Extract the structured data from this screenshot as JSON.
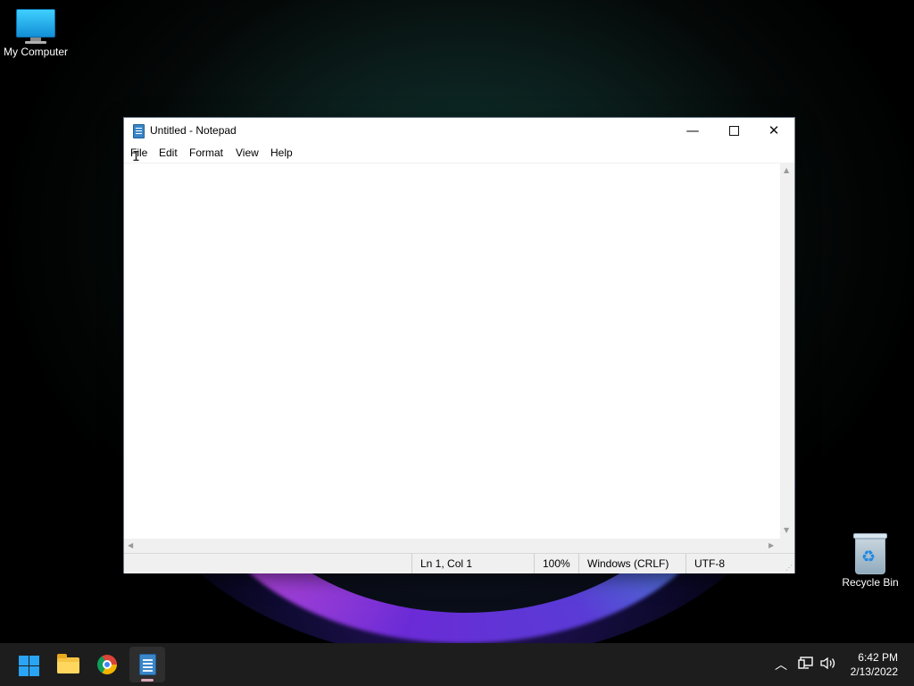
{
  "desktop": {
    "icons": [
      {
        "label": "My Computer"
      },
      {
        "label": "Recycle Bin"
      }
    ]
  },
  "notepad": {
    "title": "Untitled - Notepad",
    "controls": {
      "minimize": "—",
      "close": "✕"
    },
    "menu": [
      "File",
      "Edit",
      "Format",
      "View",
      "Help"
    ],
    "content": "",
    "status": {
      "position": "Ln 1, Col 1",
      "zoom": "100%",
      "line_ending": "Windows (CRLF)",
      "encoding": "UTF-8"
    }
  },
  "taskbar": {
    "apps": [
      {
        "name": "start",
        "icon": "windows-logo-icon"
      },
      {
        "name": "file-explorer",
        "icon": "folder-icon"
      },
      {
        "name": "chrome",
        "icon": "chrome-icon"
      },
      {
        "name": "notepad",
        "icon": "notepad-icon",
        "active": true
      }
    ],
    "tray": {
      "chevron": "︿",
      "time": "6:42 PM",
      "date": "2/13/2022"
    }
  },
  "colors": {
    "taskbar_bg": "#1d1d1d",
    "window_border": "#6f7b8a",
    "start_blue": "#2aa4f4"
  }
}
